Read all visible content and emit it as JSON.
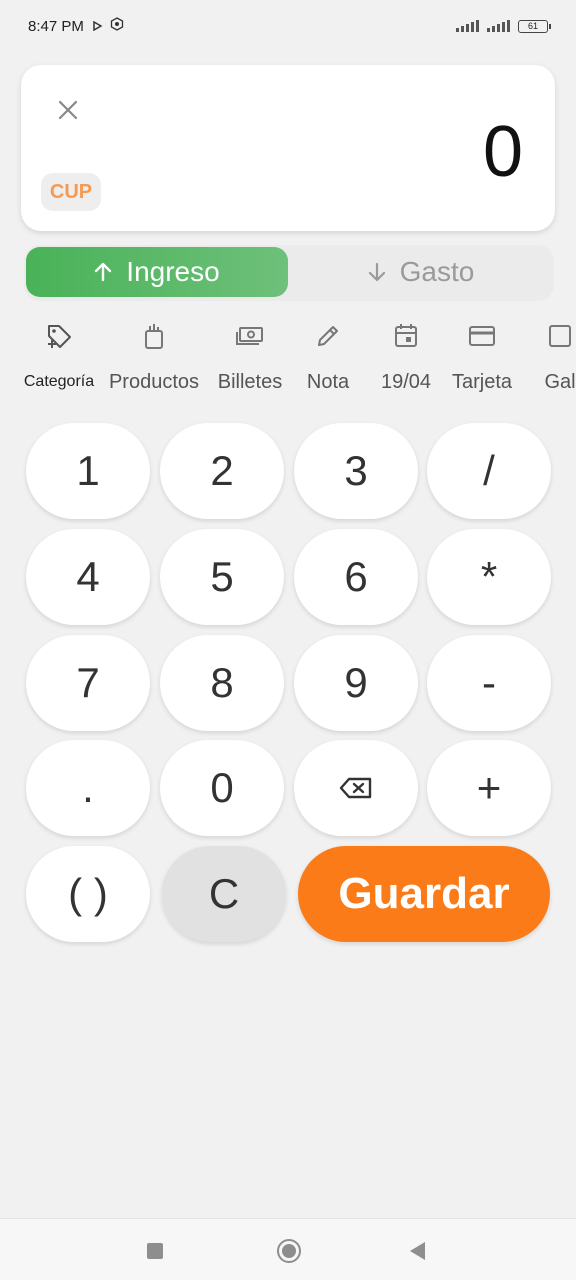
{
  "status_bar": {
    "time": "8:47 PM",
    "battery": "61"
  },
  "amount": {
    "value": "0",
    "currency": "CUP"
  },
  "type_toggle": {
    "ingreso": "Ingreso",
    "gasto": "Gasto"
  },
  "tools": [
    {
      "label": "Categoría",
      "icon": "tag-plus-icon"
    },
    {
      "label": "Productos",
      "icon": "grocery-bag-icon"
    },
    {
      "label": "Billetes",
      "icon": "banknote-icon"
    },
    {
      "label": "Nota",
      "icon": "pencil-icon"
    },
    {
      "label": "19/04",
      "icon": "calendar-icon"
    },
    {
      "label": "Tarjeta",
      "icon": "credit-card-icon"
    },
    {
      "label": "Gal",
      "icon": "gallery-icon"
    }
  ],
  "keypad": {
    "k1": "1",
    "k2": "2",
    "k3": "3",
    "divide": "/",
    "k4": "4",
    "k5": "5",
    "k6": "6",
    "multiply": "*",
    "k7": "7",
    "k8": "8",
    "k9": "9",
    "minus": "-",
    "dot": ".",
    "k0": "0",
    "plus": "+",
    "parens": "( )",
    "clear": "C",
    "save": "Guardar"
  },
  "colors": {
    "income_green": "#49b258",
    "save_orange": "#fa7b17",
    "currency_orange": "#f59a53"
  }
}
